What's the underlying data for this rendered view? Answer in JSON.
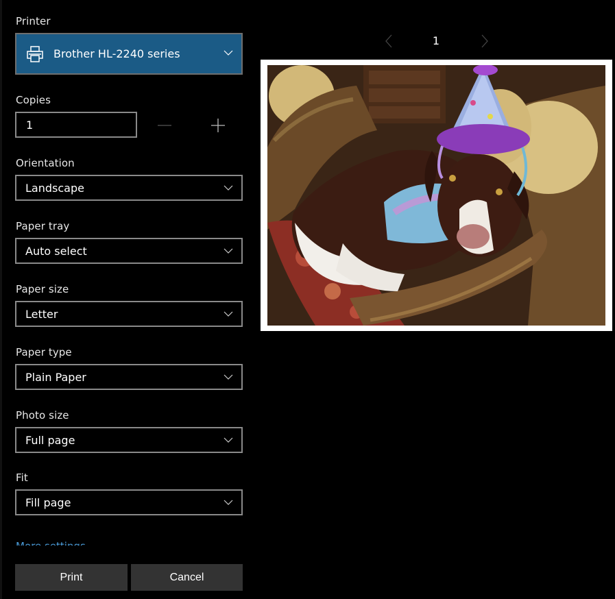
{
  "printer": {
    "label": "Printer",
    "value": "Brother HL-2240 series"
  },
  "copies": {
    "label": "Copies",
    "value": "1"
  },
  "orientation": {
    "label": "Orientation",
    "value": "Landscape"
  },
  "paper_tray": {
    "label": "Paper tray",
    "value": "Auto select"
  },
  "paper_size": {
    "label": "Paper size",
    "value": "Letter"
  },
  "paper_type": {
    "label": "Paper type",
    "value": "Plain Paper"
  },
  "photo_size": {
    "label": "Photo size",
    "value": "Full page"
  },
  "fit": {
    "label": "Fit",
    "value": "Fill page"
  },
  "more_settings": "More settings",
  "buttons": {
    "print": "Print",
    "cancel": "Cancel"
  },
  "preview": {
    "page_number": "1"
  },
  "colors": {
    "accent": "#1b5b86",
    "link": "#4a9bd8",
    "button": "#333333"
  },
  "icons": [
    "printer-icon",
    "chevron-down-icon",
    "minus-icon",
    "plus-icon",
    "chevron-left-icon",
    "chevron-right-icon"
  ]
}
